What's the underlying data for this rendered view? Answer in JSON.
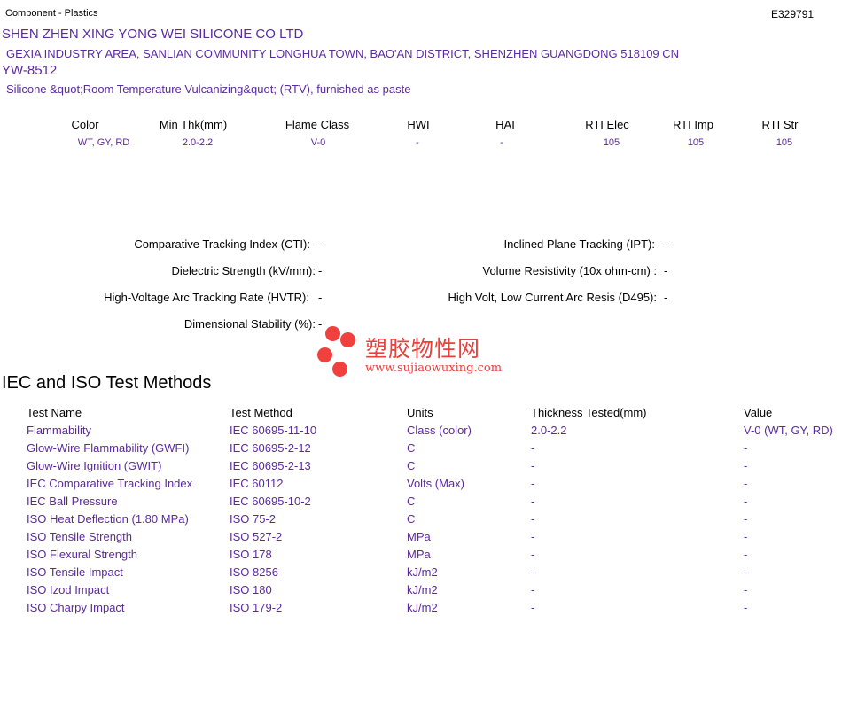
{
  "header": {
    "category": "Component - Plastics",
    "file_number": "E329791"
  },
  "company": {
    "name": "SHEN ZHEN XING YONG WEI SILICONE CO LTD",
    "address": "GEXIA INDUSTRY AREA, SANLIAN COMMUNITY LONGHUA TOWN, BAO'AN DISTRICT, SHENZHEN  GUANGDONG  518109 CN"
  },
  "product": {
    "model": "YW-8512",
    "description": "Silicone &quot;Room Temperature Vulcanizing&quot; (RTV), furnished as paste"
  },
  "ratings": {
    "headers": [
      "Color",
      "Min Thk(mm)",
      "Flame Class",
      "HWI",
      "HAI",
      "RTI Elec",
      "RTI Imp",
      "RTI Str"
    ],
    "values": [
      "WT, GY, RD",
      "2.0-2.2",
      "V-0",
      "-",
      "-",
      "105",
      "105",
      "105"
    ]
  },
  "properties": {
    "cti_label": "Comparative Tracking Index (CTI):",
    "cti_value": "-",
    "ipt_label": "Inclined Plane Tracking (IPT):",
    "ipt_value": "-",
    "dielectric_label": "Dielectric Strength (kV/mm):",
    "dielectric_value": "-",
    "volume_label": "Volume Resistivity (10x ohm-cm) :",
    "volume_value": "-",
    "hvtr_label": "High-Voltage Arc Tracking Rate (HVTR):",
    "hvtr_value": "-",
    "d495_label": "High Volt, Low Current Arc Resis (D495):",
    "d495_value": "-",
    "dimensional_label": "Dimensional Stability (%):",
    "dimensional_value": "-"
  },
  "watermark": {
    "chinese": "塑胶物性网",
    "url": "www.sujiaowuxing.com",
    "color": "#e8403b"
  },
  "test_methods": {
    "title": "IEC and ISO Test Methods",
    "headers": [
      "Test Name",
      "Test Method",
      "Units",
      "Thickness Tested(mm)",
      "Value"
    ],
    "rows": [
      [
        "Flammability",
        "IEC 60695-11-10",
        "Class (color)",
        "2.0-2.2",
        "V-0 (WT, GY, RD)"
      ],
      [
        "Glow-Wire Flammability (GWFI)",
        "IEC 60695-2-12",
        "C",
        "-",
        "-"
      ],
      [
        "Glow-Wire Ignition (GWIT)",
        "IEC 60695-2-13",
        "C",
        "-",
        "-"
      ],
      [
        "IEC Comparative Tracking Index",
        "IEC 60112",
        "Volts (Max)",
        "-",
        "-"
      ],
      [
        "IEC Ball Pressure",
        "IEC 60695-10-2",
        "C",
        "-",
        "-"
      ],
      [
        "ISO Heat Deflection (1.80 MPa)",
        "ISO 75-2",
        "C",
        "-",
        "-"
      ],
      [
        "ISO Tensile Strength",
        "ISO 527-2",
        "MPa",
        "-",
        "-"
      ],
      [
        "ISO Flexural Strength",
        "ISO 178",
        "MPa",
        "-",
        "-"
      ],
      [
        "ISO Tensile Impact",
        "ISO 8256",
        "kJ/m2",
        "-",
        "-"
      ],
      [
        "ISO Izod Impact",
        "ISO 180",
        "kJ/m2",
        "-",
        "-"
      ],
      [
        "ISO Charpy Impact",
        "ISO 179-2",
        "kJ/m2",
        "-",
        "-"
      ]
    ]
  },
  "colors": {
    "accent_text": "#5b2a9e"
  }
}
